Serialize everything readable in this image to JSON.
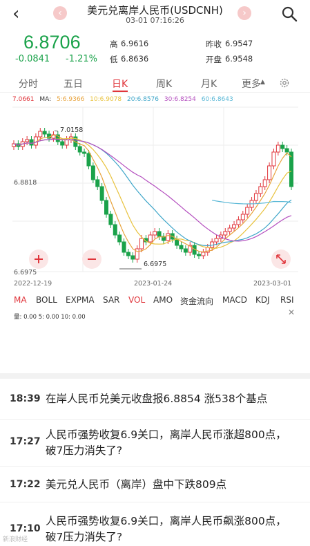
{
  "header": {
    "title": "美元兑离岸人民币(USDCNH)",
    "subtitle": "03-01 07:16:26",
    "prev_label": "‹",
    "next_label": "›"
  },
  "quote": {
    "price": "6.8706",
    "change": "-0.0841",
    "change_pct": "-1.21%",
    "high_label": "高",
    "high": "6.9616",
    "low_label": "低",
    "low": "6.8636",
    "prev_close_label": "昨收",
    "prev_close": "6.9547",
    "open_label": "开盘",
    "open": "6.9548",
    "color_down": "#1aa24a",
    "color_up": "#e0353b"
  },
  "tabs": [
    {
      "label": "分时",
      "active": false
    },
    {
      "label": "五日",
      "active": false
    },
    {
      "label": "日K",
      "active": true
    },
    {
      "label": "周K",
      "active": false
    },
    {
      "label": "月K",
      "active": false
    },
    {
      "label": "更多",
      "active": false
    }
  ],
  "ma": {
    "top_value": "7.0661",
    "label": "MA:",
    "items": [
      {
        "text": "5:6.9366",
        "color": "#e8a33d"
      },
      {
        "text": "10:6.9078",
        "color": "#e8c23d"
      },
      {
        "text": "20:6.8576",
        "color": "#3fa6c9"
      },
      {
        "text": "30:6.8254",
        "color": "#b44fbf"
      },
      {
        "text": "60:6.8643",
        "color": "#5ab8d6"
      }
    ]
  },
  "chart_data": {
    "type": "candlestick",
    "y_labels": [
      "7.0661",
      "6.8818",
      "6.6975"
    ],
    "annotations": [
      "7.0158",
      "6.6975"
    ],
    "x_labels": [
      "2022-12-19",
      "2023-01-24",
      "2023-03-01"
    ],
    "ylim": [
      6.6975,
      7.0661
    ]
  },
  "indicators": [
    "MA",
    "BOLL",
    "EXPMA",
    "SAR",
    "VOL",
    "AMO",
    "资金流向",
    "MACD",
    "KDJ",
    "RSI"
  ],
  "volume_label": "量: 0.00  5: 0.00  10: 0.00",
  "news": [
    {
      "time": "18:39",
      "text": "在岸人民币兑美元收盘报6.8854 涨538个基点"
    },
    {
      "time": "17:27",
      "text": "人民币强势收复6.9关口，离岸人民币涨超800点，破7压力消失了?"
    },
    {
      "time": "17:22",
      "text": "美元兑人民币（离岸）盘中下跌809点"
    },
    {
      "time": "17:10",
      "text": "人民币强势收复6.9关口，离岸人民币飙涨800点，破7压力消失了?"
    }
  ],
  "watermark": "新浪财经"
}
